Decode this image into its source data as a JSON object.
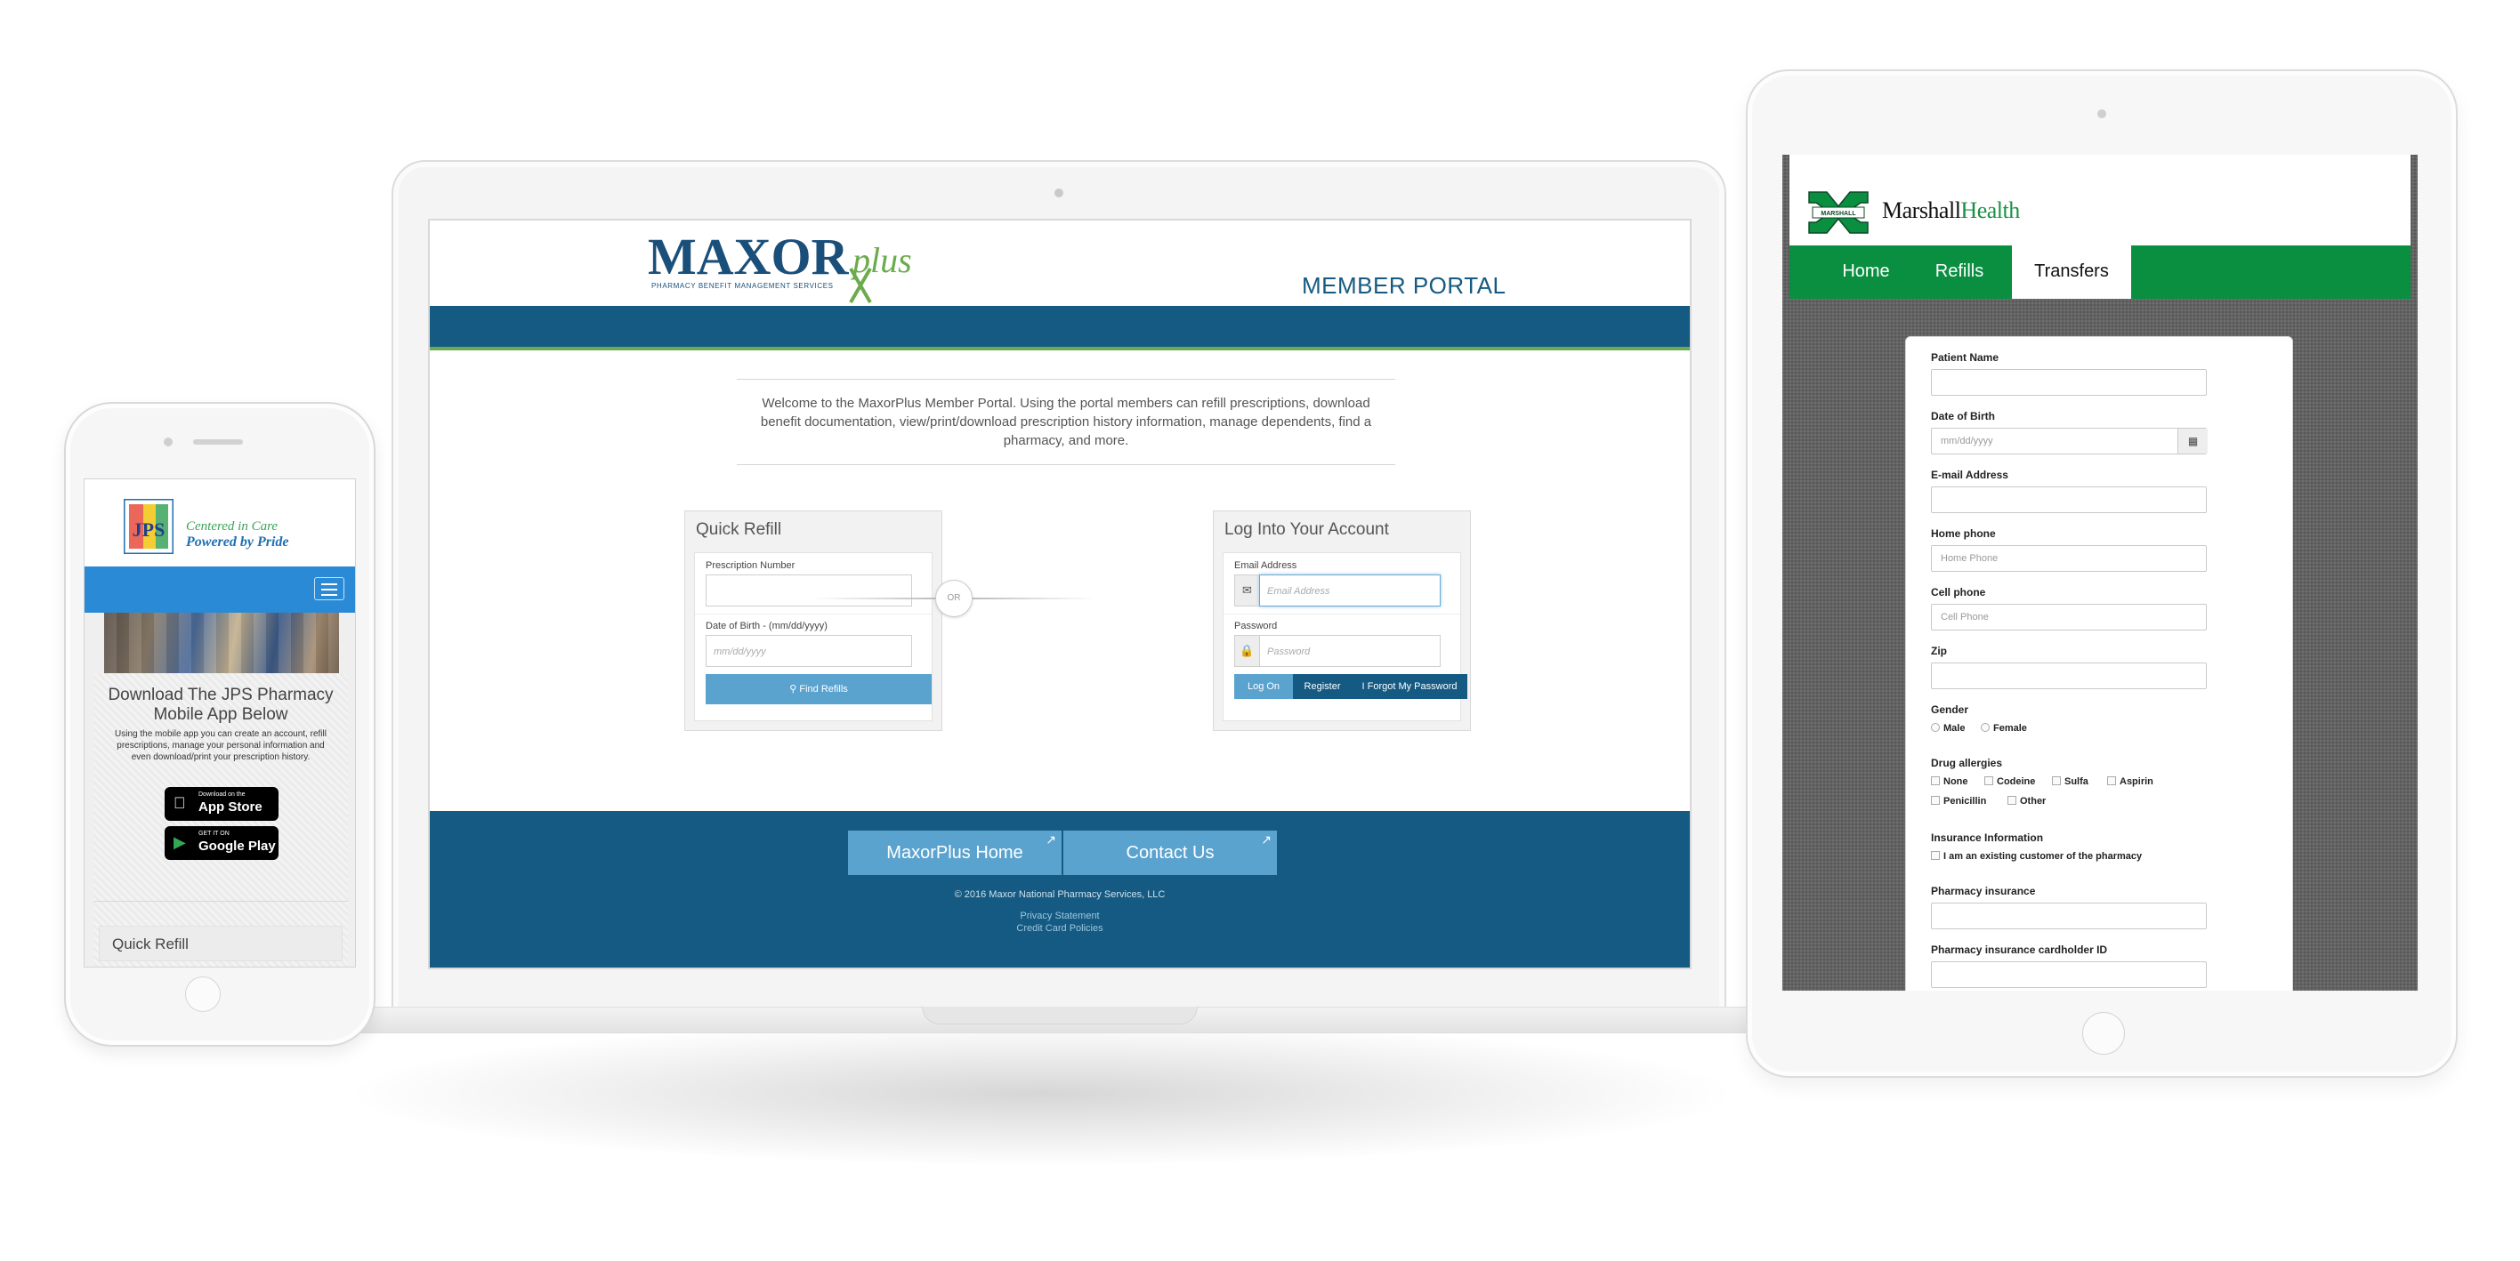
{
  "laptop": {
    "brand": "MAXOR",
    "brand_script": "plus",
    "brand_tagline": "PHARMACY BENEFIT MANAGEMENT SERVICES",
    "portal_title": "MEMBER PORTAL",
    "welcome_text": "Welcome to the MaxorPlus Member Portal. Using the portal members can refill prescriptions, download benefit documentation, view/print/download prescription history information, manage dependents, find a pharmacy, and more.",
    "quick_refill": {
      "title": "Quick Refill",
      "rx_label": "Prescription Number",
      "rx_value": "",
      "dob_label": "Date of Birth - (mm/dd/yyyy)",
      "dob_placeholder": "mm/dd/yyyy",
      "button": "Find Refills"
    },
    "or_label": "OR",
    "login": {
      "title": "Log Into Your Account",
      "email_label": "Email Address",
      "email_placeholder": "Email Address",
      "password_label": "Password",
      "password_placeholder": "Password",
      "log_on": "Log On",
      "register": "Register",
      "forgot": "I Forgot My Password"
    },
    "footer": {
      "home_button": "MaxorPlus Home",
      "contact_button": "Contact Us",
      "copyright": "© 2016 Maxor National Pharmacy Services, LLC",
      "privacy": "Privacy Statement",
      "credit_card": "Credit Card Policies"
    },
    "colors": {
      "primary": "#155a82",
      "accent": "#5ba3cf",
      "green": "#6bab4d"
    }
  },
  "phone": {
    "logo_letters": "JPS",
    "tagline_1": "Centered in Care",
    "tagline_2": "Powered by Pride",
    "download_heading": "Download The JPS Pharmacy Mobile App Below",
    "download_text": "Using the mobile app you can create an account, refill prescriptions, manage your personal information and even download/print your prescription history.",
    "app_store_small": "Download on the",
    "app_store_big": "App Store",
    "google_small": "GET IT ON",
    "google_big": "Google Play",
    "quick_refill": "Quick Refill",
    "menu_icon": "hamburger-icon",
    "colors": {
      "nav": "#2a8ad5"
    }
  },
  "tablet": {
    "logo_badge": "MARSHALL",
    "brand_1": "Marshall",
    "brand_2": "Health",
    "tabs": [
      {
        "label": "Home"
      },
      {
        "label": "Refills"
      },
      {
        "label": "Transfers"
      }
    ],
    "form": {
      "patient_name": "Patient Name",
      "dob": "Date of Birth",
      "dob_placeholder": "mm/dd/yyyy",
      "email": "E-mail Address",
      "home_phone": "Home phone",
      "home_phone_placeholder": "Home Phone",
      "cell_phone": "Cell phone",
      "cell_phone_placeholder": "Cell Phone",
      "zip": "Zip",
      "gender": "Gender",
      "male": "Male",
      "female": "Female",
      "drug_allergies": "Drug allergies",
      "allergy_none": "None",
      "allergy_codeine": "Codeine",
      "allergy_sulfa": "Sulfa",
      "allergy_aspirin": "Aspirin",
      "allergy_penicillin": "Penicillin",
      "allergy_other": "Other",
      "insurance_info": "Insurance Information",
      "existing_customer": "I am an existing customer of the pharmacy",
      "pharmacy_insurance": "Pharmacy insurance",
      "cardholder_id": "Pharmacy insurance cardholder ID"
    },
    "colors": {
      "nav": "#0a8f41",
      "brand_green": "#1b9145"
    }
  }
}
